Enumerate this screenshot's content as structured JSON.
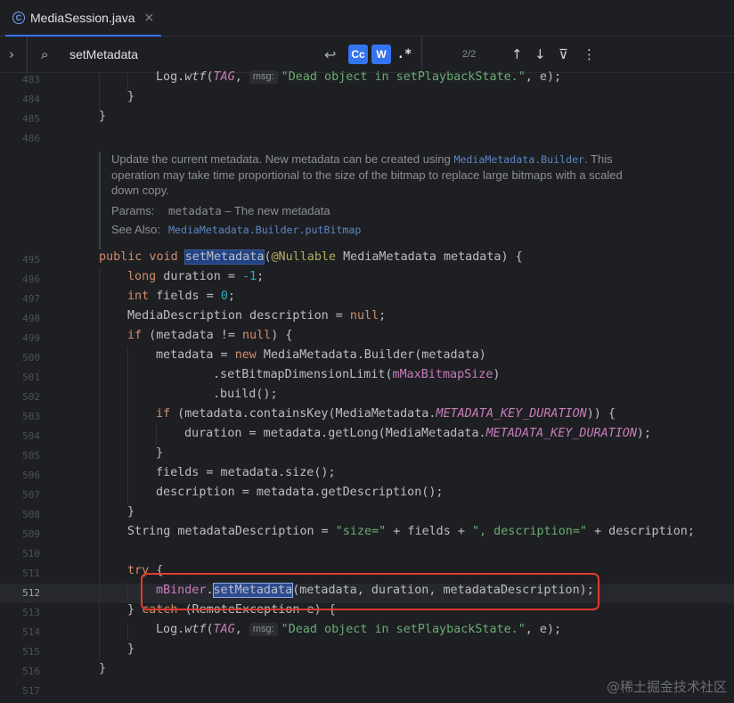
{
  "tab": {
    "file_icon": "C",
    "file_name": "MediaSession.java",
    "close_glyph": "×"
  },
  "search": {
    "expand_glyph": "›",
    "search_glyph": "⌕",
    "query": "setMetadata",
    "clear_glyph": "↩",
    "match_case": "Cc",
    "words": "W",
    "regex": ".*",
    "match_count": "2/2",
    "prev_glyph": "↑",
    "next_glyph": "↓",
    "filter_glyph": "⊽",
    "more_glyph": "⋮"
  },
  "gutter": [
    "483",
    "484",
    "485",
    "486",
    "495",
    "496",
    "497",
    "498",
    "499",
    "500",
    "501",
    "502",
    "503",
    "504",
    "505",
    "506",
    "507",
    "508",
    "509",
    "510",
    "511",
    "512",
    "513",
    "514",
    "515",
    "516",
    "517"
  ],
  "current_line": "512",
  "doc": {
    "text_before": "Update the current metadata. New metadata can be created using ",
    "link1": "MediaMetadata.Builder",
    "text_after": ". This operation may take time proportional to the size of the bitmap to replace large bitmaps with a scaled down copy.",
    "params_label": "Params:",
    "param_name": "metadata",
    "param_desc": " – The new metadata",
    "see_also_label": "See Also:",
    "see_also_link": "MediaMetadata.Builder.putBitmap"
  },
  "code": {
    "l483_call": "Log.",
    "l483_method": "wtf",
    "l483_open": "(",
    "l483_tag": "TAG",
    "l483_comma": ", ",
    "l483_hint": "msg:",
    "l483_str": "\"Dead object in setPlaybackState.\"",
    "l483_end": ", e);",
    "l484": "}",
    "l485": "}",
    "l495_kw": "public void ",
    "l495_hl": "setMetadata",
    "l495_open": "(",
    "l495_ann": "@Nullable",
    "l495_rest": " MediaMetadata metadata) {",
    "l496_kw": "long",
    "l496_mid": " duration = ",
    "l496_num": "-1",
    "l496_end": ";",
    "l497_kw": "int",
    "l497_mid": " fields = ",
    "l497_num": "0",
    "l497_end": ";",
    "l498_mid": "MediaDescription description = ",
    "l498_kw": "null",
    "l498_end": ";",
    "l499_kw": "if",
    "l499_mid": " (metadata != ",
    "l499_kw2": "null",
    "l499_end": ") {",
    "l500_mid": "metadata = ",
    "l500_kw": "new",
    "l500_end": " MediaMetadata.Builder(metadata)",
    "l501_mid": ".setBitmapDimensionLimit(",
    "l501_field": "mMaxBitmapSize",
    "l501_end": ")",
    "l502": ".build();",
    "l503_kw": "if",
    "l503_mid": " (metadata.containsKey(MediaMetadata.",
    "l503_const": "METADATA_KEY_DURATION",
    "l503_end": ")) {",
    "l504_mid": "duration = metadata.getLong(MediaMetadata.",
    "l504_const": "METADATA_KEY_DURATION",
    "l504_end": ");",
    "l505": "}",
    "l506": "fields = metadata.size();",
    "l507": "description = metadata.getDescription();",
    "l508": "}",
    "l509_mid": "String metadataDescription = ",
    "l509_str1": "\"size=\"",
    "l509_mid2": " + fields + ",
    "l509_str2": "\", description=\"",
    "l509_end": " + description;",
    "l511_kw": "try",
    "l511_end": " {",
    "l512_field": "mBinder",
    "l512_dot": ".",
    "l512_hl": "setMetadata",
    "l512_end": "(metadata, duration, metadataDescription);",
    "l513_open": "} ",
    "l513_kw": "catch",
    "l513_end": " (RemoteException e) {",
    "l514_call": "Log.",
    "l514_method": "wtf",
    "l514_open": "(",
    "l514_tag": "TAG",
    "l514_comma": ", ",
    "l514_hint": "msg:",
    "l514_str": "\"Dead object in setPlaybackState.\"",
    "l514_end": ", e);",
    "l515": "}",
    "l516": "}"
  },
  "watermark": "@稀土掘金技术社区",
  "colors": {
    "accent": "#3574f0",
    "annotation": "#e03c2e",
    "background": "#1e1f22"
  }
}
